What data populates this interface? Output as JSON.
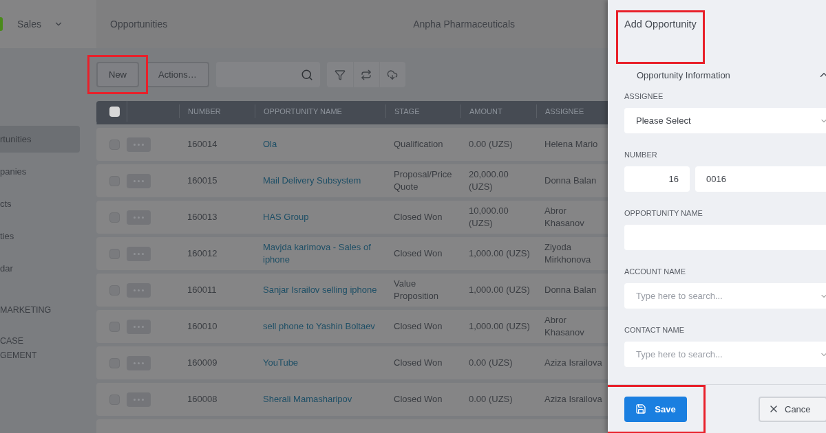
{
  "app": {
    "module": "Sales"
  },
  "header": {
    "page_title": "Opportunities",
    "company": "Anpha Pharmaceuticals"
  },
  "sidebar": {
    "items": [
      {
        "label": "rtunities",
        "selected": true
      },
      {
        "label": "panies",
        "selected": false
      },
      {
        "label": "cts",
        "selected": false
      },
      {
        "label": "ties",
        "selected": false
      },
      {
        "label": "dar",
        "selected": false
      },
      {
        "label": "MARKETING",
        "selected": false,
        "kind": "section"
      },
      {
        "label": "CASE",
        "selected": false,
        "kind": "section"
      },
      {
        "label": "GEMENT",
        "selected": false,
        "kind": "section"
      }
    ]
  },
  "toolbar": {
    "new_button": {
      "label": "New",
      "highlighted": true
    },
    "actions_button": {
      "label": "Actions…"
    }
  },
  "table": {
    "all_checked": false,
    "columns": [
      "NUMBER",
      "OPPORTUNITY NAME",
      "STAGE",
      "AMOUNT",
      "ASSIGNEE"
    ],
    "rows": [
      {
        "checked": false,
        "number": "160014",
        "name": "Ola",
        "stage": "Qualification",
        "amount": "0.00 (UZS)",
        "assignee": "Helena Mario"
      },
      {
        "checked": false,
        "number": "160015",
        "name": "Mail Delivery Subsystem",
        "stage": "Proposal/Price Quote",
        "amount": "20,000.00 (UZS)",
        "assignee": "Donna Balan"
      },
      {
        "checked": false,
        "number": "160013",
        "name": "HAS Group",
        "stage": "Closed Won",
        "amount": "10,000.00 (UZS)",
        "assignee": "Abror Khasanov"
      },
      {
        "checked": false,
        "number": "160012",
        "name": "Mavjda karimova - Sales of iphone",
        "stage": "Closed Won",
        "amount": "1,000.00 (UZS)",
        "assignee": "Ziyoda Mirkhonova"
      },
      {
        "checked": false,
        "number": "160011",
        "name": "Sanjar Israilov selling iphone",
        "stage": "Value Proposition",
        "amount": "1,000.00 (UZS)",
        "assignee": "Donna Balan"
      },
      {
        "checked": false,
        "number": "160010",
        "name": "sell phone to Yashin Boltaev",
        "stage": "Closed Won",
        "amount": "1,000.00 (UZS)",
        "assignee": "Abror Khasanov"
      },
      {
        "checked": false,
        "number": "160009",
        "name": "YouTube",
        "stage": "Closed Won",
        "amount": "0.00 (UZS)",
        "assignee": "Aziza Israilova"
      },
      {
        "checked": false,
        "number": "160008",
        "name": "Sherali Mamasharipov",
        "stage": "Closed Won",
        "amount": "0.00 (UZS)",
        "assignee": "Aziza Israilova"
      }
    ]
  },
  "panel": {
    "title": "Add Opportunity",
    "title_highlighted": true,
    "section": {
      "label": "Opportunity Information",
      "expanded": true
    },
    "fields": [
      {
        "kind": "select",
        "label": "ASSIGNEE",
        "value": "Please Select"
      },
      {
        "kind": "number",
        "label": "NUMBER",
        "prefix": "16",
        "value": "0016"
      },
      {
        "kind": "text",
        "label": "OPPORTUNITY NAME"
      },
      {
        "kind": "search",
        "label": "ACCOUNT NAME",
        "placeholder": "Type here to search..."
      },
      {
        "kind": "search",
        "label": "CONTACT NAME",
        "placeholder": "Type here to search..."
      }
    ],
    "save": {
      "label": "Save",
      "highlighted": true
    },
    "cancel": {
      "label": "Cance"
    }
  }
}
